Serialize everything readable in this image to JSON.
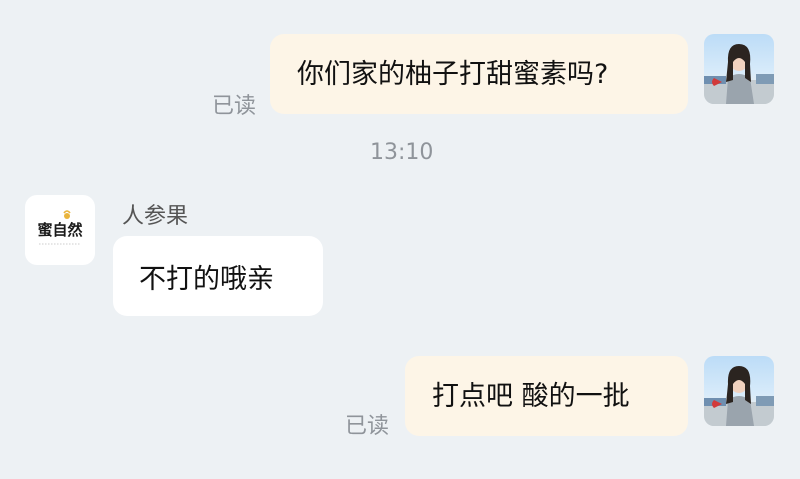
{
  "messages": [
    {
      "direction": "outgoing",
      "text": "你们家的柚子打甜蜜素吗?",
      "status": "已读"
    },
    {
      "direction": "incoming",
      "sender": "人参果",
      "text": "不打的哦亲"
    },
    {
      "direction": "outgoing",
      "text": "打点吧 酸的一批",
      "status": "已读"
    }
  ],
  "timestamp": "13:10",
  "avatars": {
    "user": "user-photo-avatar",
    "shop_logo_text": "蜜自然"
  },
  "colors": {
    "background": "#edf1f4",
    "outgoing_bubble": "#fdf5e7",
    "incoming_bubble": "#ffffff",
    "status_text": "#8f949a"
  }
}
